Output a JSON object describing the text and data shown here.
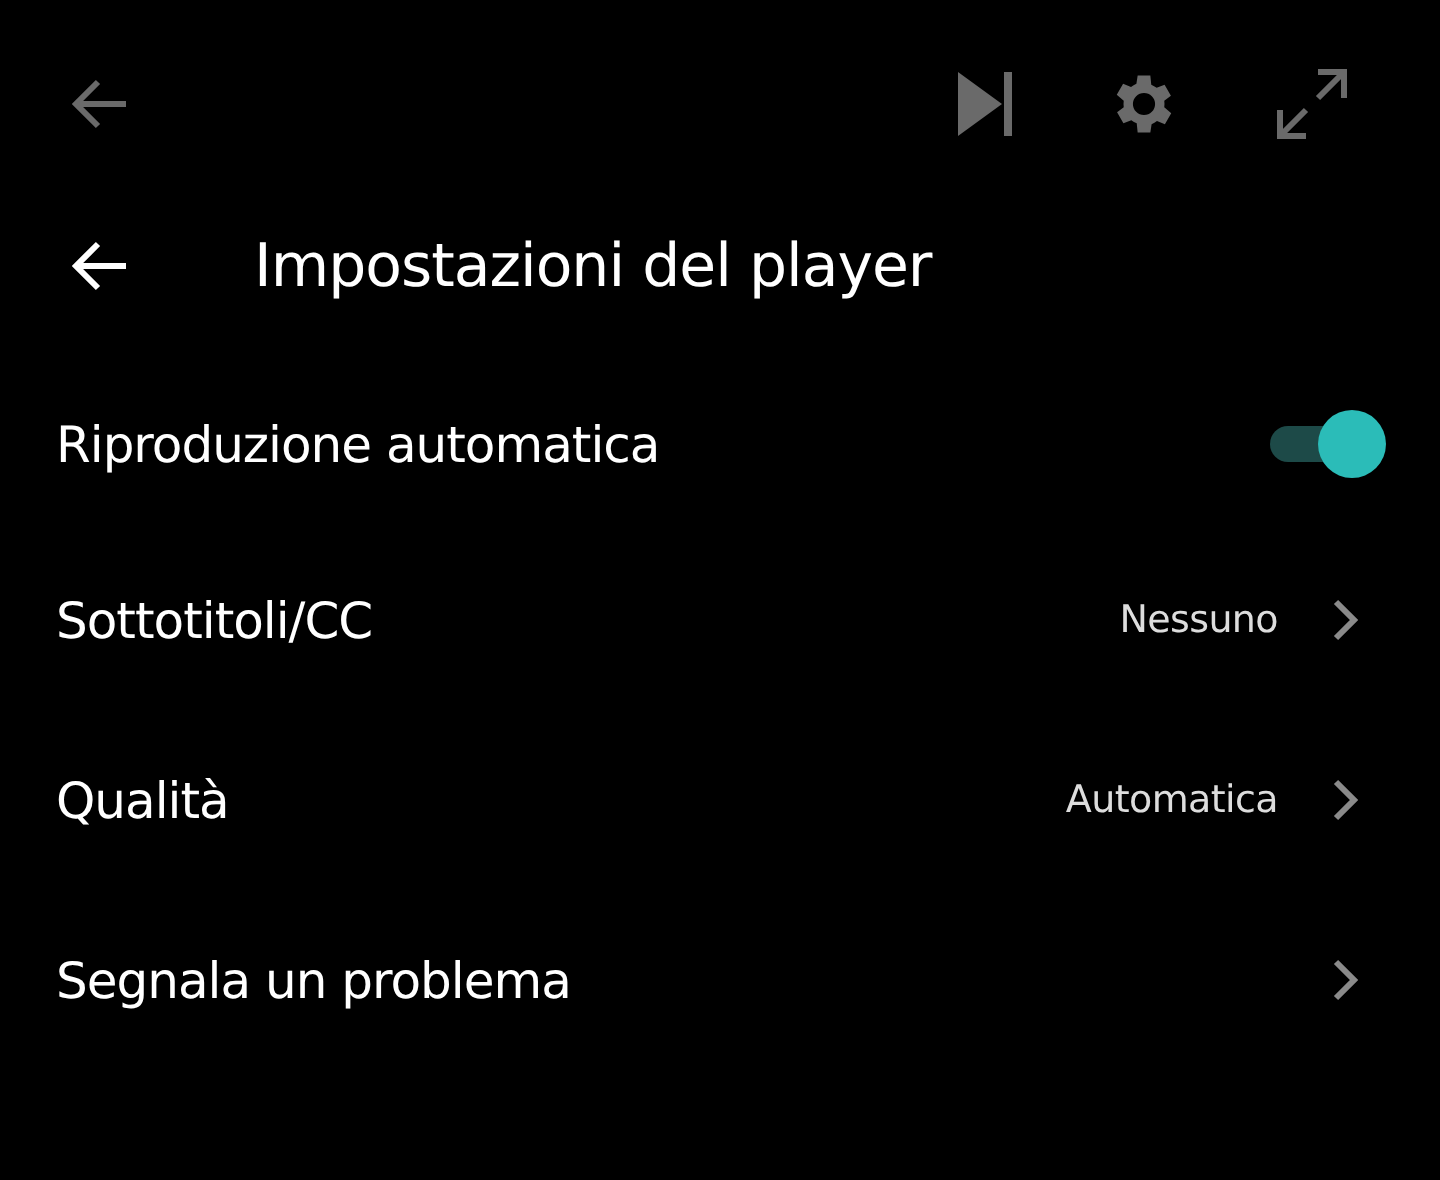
{
  "panel": {
    "title": "Impostazioni del player"
  },
  "settings": [
    {
      "kind": "toggle",
      "label": "Riproduzione automatica",
      "on": true
    },
    {
      "kind": "link",
      "label": "Sottotitoli/CC",
      "value": "Nessuno"
    },
    {
      "kind": "link",
      "label": "Qualità",
      "value": "Automatica"
    },
    {
      "kind": "link",
      "label": "Segnala un problema"
    }
  ]
}
